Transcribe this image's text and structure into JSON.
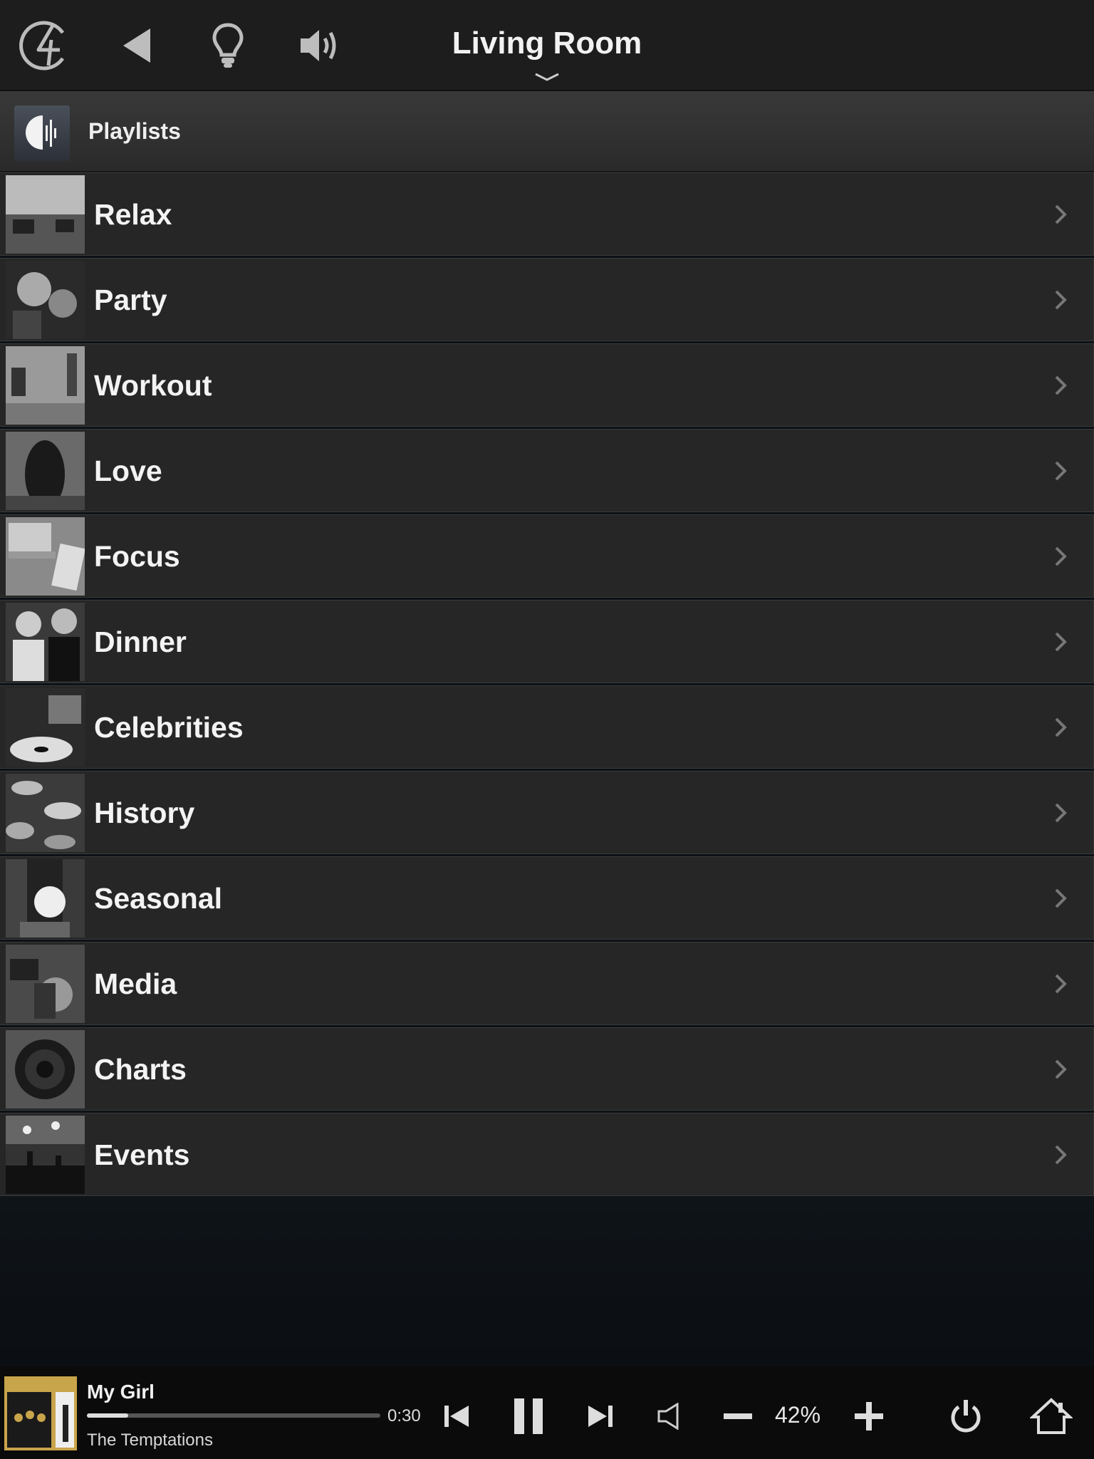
{
  "header": {
    "title": "Living Room",
    "icons": [
      "logo-4-icon",
      "back-icon",
      "lightbulb-icon",
      "speaker-icon",
      "chevron-down-icon"
    ]
  },
  "section": {
    "title": "Playlists",
    "icon": "playlists-icon"
  },
  "playlists": [
    {
      "label": "Relax"
    },
    {
      "label": "Party"
    },
    {
      "label": "Workout"
    },
    {
      "label": "Love"
    },
    {
      "label": "Focus"
    },
    {
      "label": "Dinner"
    },
    {
      "label": "Celebrities"
    },
    {
      "label": "History"
    },
    {
      "label": "Seasonal"
    },
    {
      "label": "Media"
    },
    {
      "label": "Charts"
    },
    {
      "label": "Events"
    }
  ],
  "player": {
    "title": "My Girl",
    "artist": "The Temptations",
    "elapsed": "0:30",
    "progress_fraction": 0.14,
    "volume": "42%"
  },
  "colors": {
    "topbar": "#1d1d1d",
    "row": "#262626",
    "background": "#0d1116"
  }
}
